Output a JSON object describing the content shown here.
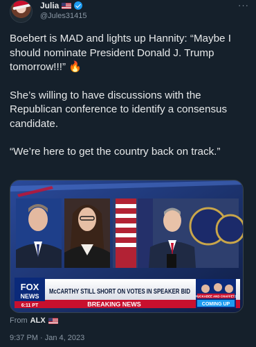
{
  "user": {
    "display_name": "Julia",
    "handle": "@Jules31415"
  },
  "tweet": {
    "paragraphs": [
      "Boebert is MAD and lights up Hannity: “Maybe I should nominate President Donald J. Trump tomorrow!!!” 🔥",
      "She’s willing to have discussions with the Republican conference to identify a consensus candidate.",
      "“We’re here to get the country back on track.”"
    ]
  },
  "media": {
    "network_top": "FOX",
    "network_bottom": "NEWS",
    "time_badge": "6:11 PT",
    "headline": "McCARTHY STILL SHORT ON VOTES IN SPEAKER BID",
    "breaking": "BREAKING NEWS",
    "coming_up_show": "HUCKABEE AND CHAFFETZ",
    "coming_up": "COMING UP"
  },
  "source": {
    "from_label": "From",
    "name": "ALX"
  },
  "timestamp": "9:37 PM · Jan 4, 2023",
  "icons": [
    "flag-icon",
    "verified-badge-icon",
    "more-options-icon"
  ],
  "colors": {
    "background": "#15202b",
    "verified": "#1d9bf0",
    "secondary_text": "#8b98a5",
    "breaking_red": "#c8102e"
  }
}
